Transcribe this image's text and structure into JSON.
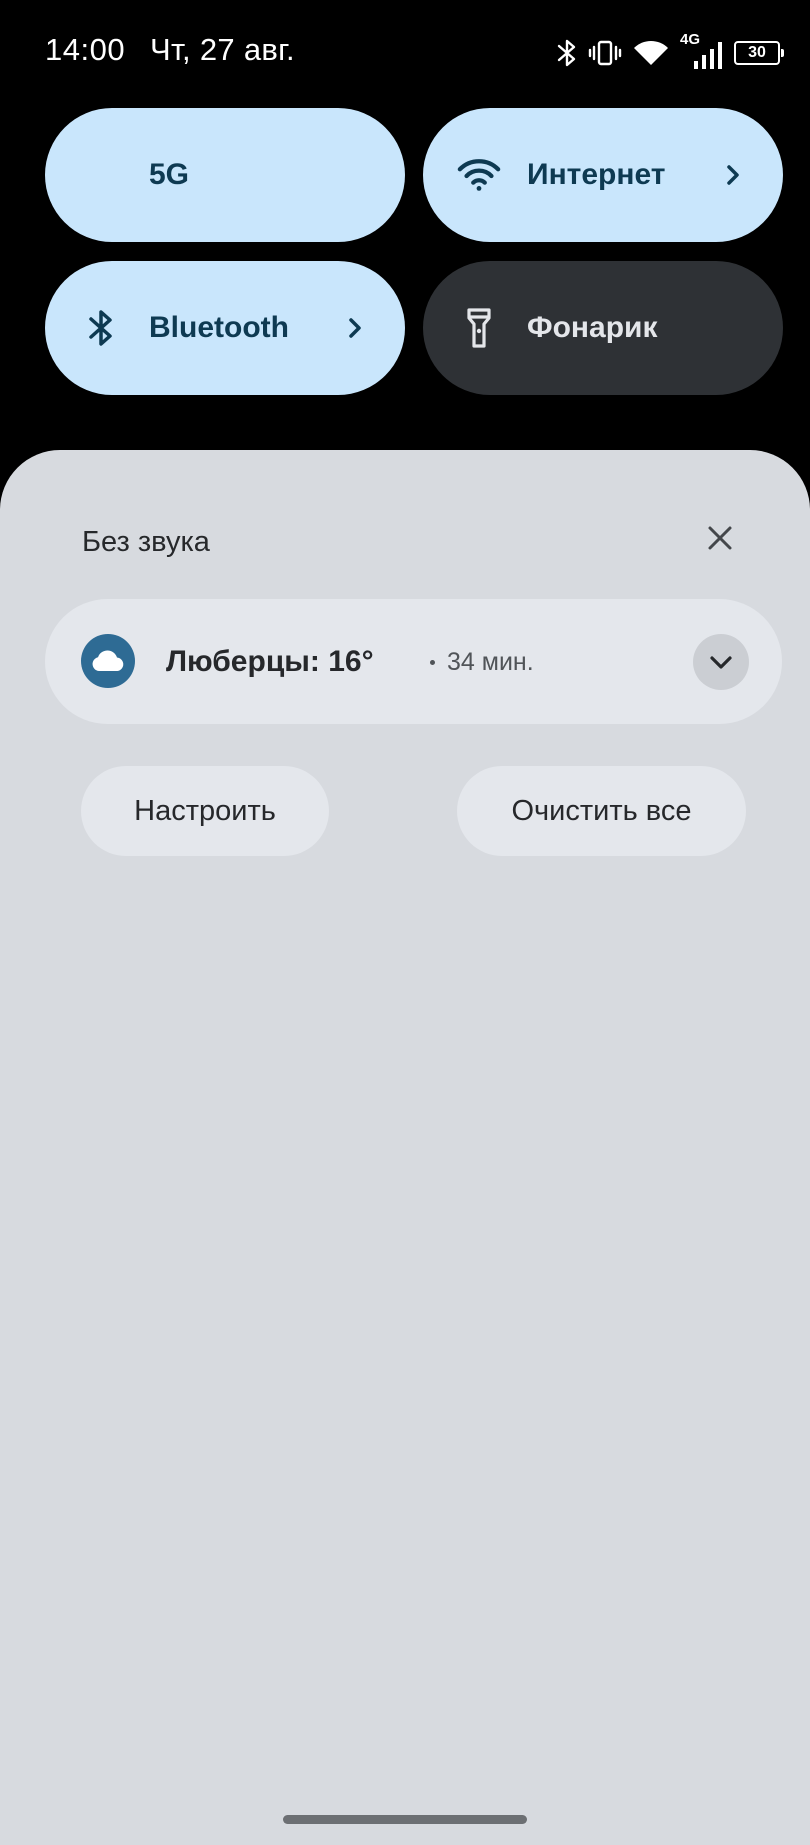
{
  "status_bar": {
    "time": "14:00",
    "date": "Чт, 27 авг.",
    "network_type": "4G",
    "battery_level": "30",
    "icons": [
      "bluetooth-icon",
      "vibrate-icon",
      "wifi-icon",
      "cellular-signal-icon",
      "battery-icon"
    ]
  },
  "quick_settings": {
    "tiles": [
      {
        "label": "5G",
        "state": "on",
        "icon": ""
      },
      {
        "label": "Интернет",
        "state": "on",
        "icon": "wifi-icon",
        "has_chevron": true
      },
      {
        "label": "Bluetooth",
        "state": "on",
        "icon": "bluetooth-icon",
        "has_chevron": true
      },
      {
        "label": "Фонарик",
        "state": "off",
        "icon": "flashlight-icon"
      }
    ]
  },
  "notifications": {
    "section_title": "Без звука",
    "items": [
      {
        "app_icon": "cloud-icon",
        "title": "Люберцы: 16°",
        "time": "34 мин."
      }
    ],
    "actions": {
      "configure": "Настроить",
      "clear_all": "Очистить все"
    }
  },
  "colors": {
    "tile_on_bg": "#c9e6fc",
    "tile_on_text": "#0e3a52",
    "tile_off_bg": "#2e3135",
    "shade_bg": "#d7dadf",
    "card_bg": "#e4e7ec",
    "weather_icon_bg": "#2e6b94"
  }
}
